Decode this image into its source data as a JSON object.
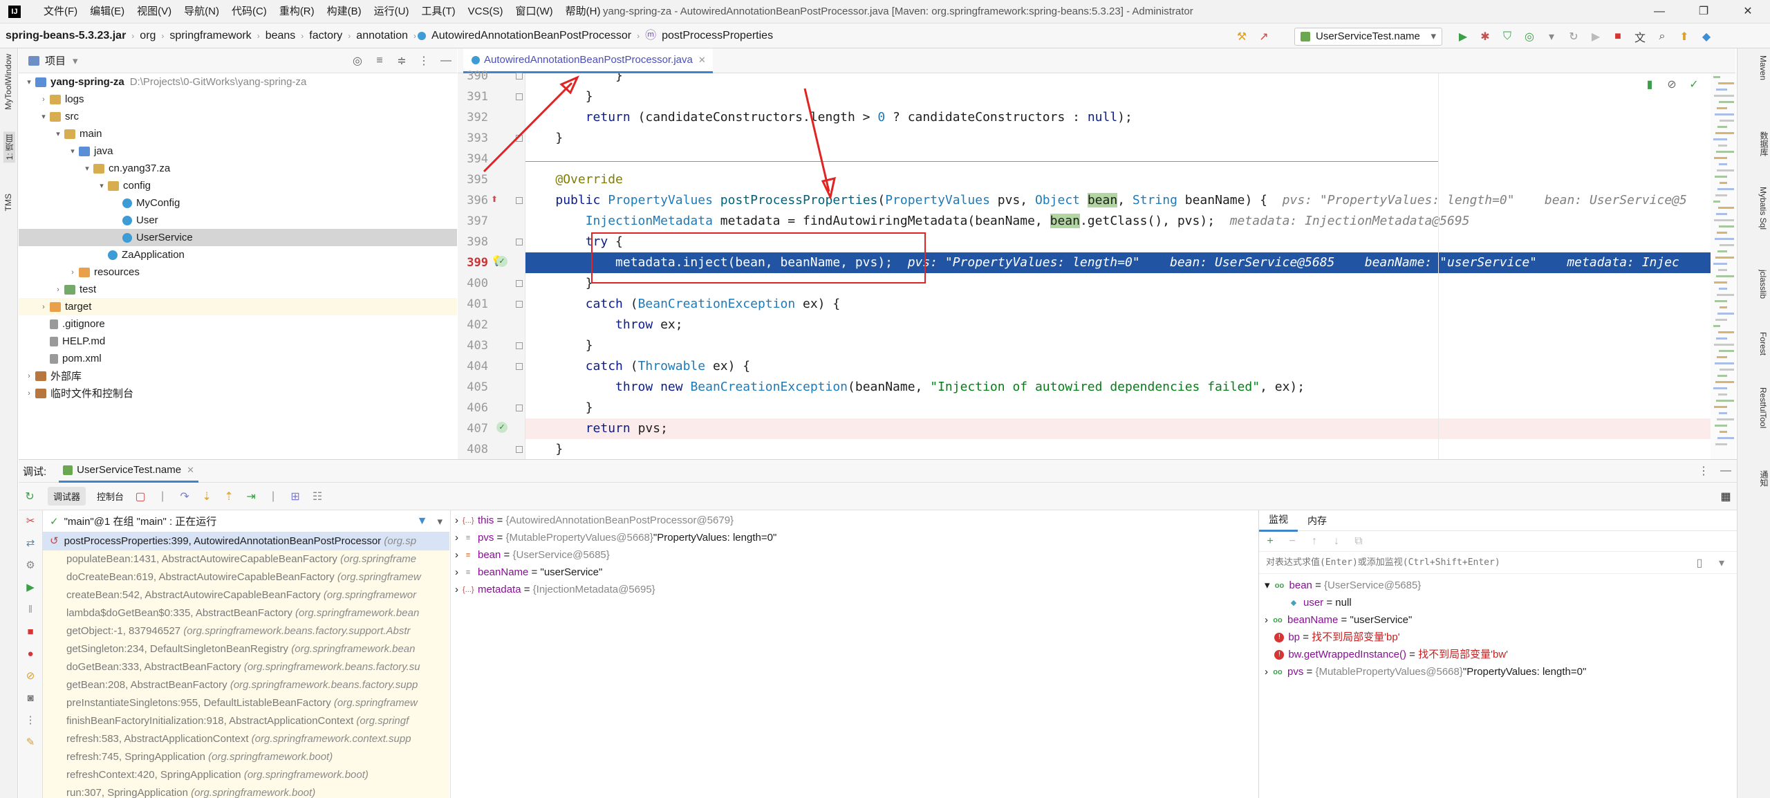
{
  "titlebar": {
    "menu": [
      "文件(F)",
      "编辑(E)",
      "视图(V)",
      "导航(N)",
      "代码(C)",
      "重构(R)",
      "构建(B)",
      "运行(U)",
      "工具(T)",
      "VCS(S)",
      "窗口(W)",
      "帮助(H)"
    ],
    "window_title": "yang-spring-za - AutowiredAnnotationBeanPostProcessor.java [Maven: org.springframework:spring-beans:5.3.23] - Administrator"
  },
  "navbar": {
    "breadcrumbs": [
      "spring-beans-5.3.23.jar",
      "org",
      "springframework",
      "beans",
      "factory",
      "annotation",
      "AutowiredAnnotationBeanPostProcessor",
      "postProcessProperties"
    ],
    "run_config": "UserServiceTest.name"
  },
  "left_stripe": [
    "MyToolWindow",
    "1: 项目",
    "TMS"
  ],
  "right_stripe": [
    "Maven",
    "数据库",
    "Mybatis Sql",
    "jclasslib",
    "Forest",
    "RestfulTool",
    "通知"
  ],
  "project": {
    "header": "项目",
    "tree": [
      {
        "label": "yang-spring-za",
        "path": "D:\\Projects\\0-GitWorks\\yang-spring-za",
        "depth": 0,
        "arrow": "▾",
        "icon": "folder-b",
        "bold": true
      },
      {
        "label": "logs",
        "depth": 1,
        "arrow": "›",
        "icon": "folder"
      },
      {
        "label": "src",
        "depth": 1,
        "arrow": "▾",
        "icon": "folder"
      },
      {
        "label": "main",
        "depth": 2,
        "arrow": "▾",
        "icon": "folder"
      },
      {
        "label": "java",
        "depth": 3,
        "arrow": "▾",
        "icon": "folder-b"
      },
      {
        "label": "cn.yang37.za",
        "depth": 4,
        "arrow": "▾",
        "icon": "folder"
      },
      {
        "label": "config",
        "depth": 5,
        "arrow": "▾",
        "icon": "folder"
      },
      {
        "label": "MyConfig",
        "depth": 6,
        "arrow": "",
        "icon": "class"
      },
      {
        "label": "User",
        "depth": 6,
        "arrow": "",
        "icon": "class"
      },
      {
        "label": "UserService",
        "depth": 6,
        "arrow": "",
        "icon": "class",
        "selected": true
      },
      {
        "label": "ZaApplication",
        "depth": 5,
        "arrow": "",
        "icon": "class"
      },
      {
        "label": "resources",
        "depth": 3,
        "arrow": "›",
        "icon": "folder-o"
      },
      {
        "label": "test",
        "depth": 2,
        "arrow": "›",
        "icon": "folder-g"
      },
      {
        "label": "target",
        "depth": 1,
        "arrow": "›",
        "icon": "folder-o",
        "excluded": true
      },
      {
        "label": ".gitignore",
        "depth": 1,
        "arrow": "",
        "icon": "file"
      },
      {
        "label": "HELP.md",
        "depth": 1,
        "arrow": "",
        "icon": "file"
      },
      {
        "label": "pom.xml",
        "depth": 1,
        "arrow": "",
        "icon": "file"
      },
      {
        "label": "外部库",
        "depth": 0,
        "arrow": "›",
        "icon": "lib"
      },
      {
        "label": "临时文件和控制台",
        "depth": 0,
        "arrow": "›",
        "icon": "lib"
      }
    ]
  },
  "editor": {
    "tab": "AutowiredAnnotationBeanPostProcessor.java",
    "line_numbers": [
      "390",
      "391",
      "392",
      "393",
      "394",
      "395",
      "396",
      "397",
      "398",
      "399",
      "400",
      "401",
      "402",
      "403",
      "404",
      "405",
      "406",
      "407",
      "408"
    ],
    "current_line": "399"
  },
  "debug": {
    "label": "调试:",
    "session_tab": "UserServiceTest.name",
    "sub_tabs": [
      "调试器",
      "控制台"
    ],
    "thread": "\"main\"@1 在组 \"main\" : 正在运行",
    "frames": [
      {
        "method": "postProcessProperties:399, AutowiredAnnotationBeanPostProcessor",
        "pkg": "(org.sp"
      },
      {
        "method": "populateBean:1431, AbstractAutowireCapableBeanFactory",
        "pkg": "(org.springframe"
      },
      {
        "method": "doCreateBean:619, AbstractAutowireCapableBeanFactory",
        "pkg": "(org.springframew"
      },
      {
        "method": "createBean:542, AbstractAutowireCapableBeanFactory",
        "pkg": "(org.springframewor"
      },
      {
        "method": "lambda$doGetBean$0:335, AbstractBeanFactory",
        "pkg": "(org.springframework.bean"
      },
      {
        "method": "getObject:-1, 837946527",
        "pkg": "(org.springframework.beans.factory.support.Abstr"
      },
      {
        "method": "getSingleton:234, DefaultSingletonBeanRegistry",
        "pkg": "(org.springframework.bean"
      },
      {
        "method": "doGetBean:333, AbstractBeanFactory",
        "pkg": "(org.springframework.beans.factory.su"
      },
      {
        "method": "getBean:208, AbstractBeanFactory",
        "pkg": "(org.springframework.beans.factory.supp"
      },
      {
        "method": "preInstantiateSingletons:955, DefaultListableBeanFactory",
        "pkg": "(org.springframew"
      },
      {
        "method": "finishBeanFactoryInitialization:918, AbstractApplicationContext",
        "pkg": "(org.springf"
      },
      {
        "method": "refresh:583, AbstractApplicationContext",
        "pkg": "(org.springframework.context.supp"
      },
      {
        "method": "refresh:745, SpringApplication",
        "pkg": "(org.springframework.boot)"
      },
      {
        "method": "refreshContext:420, SpringApplication",
        "pkg": "(org.springframework.boot)"
      },
      {
        "method": "run:307, SpringApplication",
        "pkg": "(org.springframework.boot)"
      }
    ],
    "variables": [
      {
        "name": "this",
        "value": "{AutowiredAnnotationBeanPostProcessor@5679}",
        "extra": ""
      },
      {
        "name": "pvs",
        "value": "{MutablePropertyValues@5668}",
        "extra": "\"PropertyValues: length=0\""
      },
      {
        "name": "bean",
        "value": "{UserService@5685}",
        "extra": ""
      },
      {
        "name": "beanName",
        "value": "",
        "extra": "\"userService\""
      },
      {
        "name": "metadata",
        "value": "{InjectionMetadata@5695}",
        "extra": ""
      }
    ],
    "watch_tabs": [
      "监视",
      "内存"
    ],
    "watch_placeholder": "对表达式求值(Enter)或添加监视(Ctrl+Shift+Enter)",
    "watches": [
      {
        "name": "bean",
        "value": "{UserService@5685}",
        "extra": "",
        "kind": "watch",
        "expanded": true
      },
      {
        "name": "user",
        "value": "",
        "extra": "null",
        "kind": "field",
        "child": true
      },
      {
        "name": "beanName",
        "value": "",
        "extra": "\"userService\"",
        "kind": "watch"
      },
      {
        "name": "bp",
        "value": "",
        "extra": "找不到局部变量'bp'",
        "kind": "error"
      },
      {
        "name": "bw.getWrappedInstance()",
        "value": "",
        "extra": "找不到局部变量'bw'",
        "kind": "error"
      },
      {
        "name": "pvs",
        "value": "{MutablePropertyValues@5668}",
        "extra": "\"PropertyValues: length=0\"",
        "kind": "watch"
      }
    ]
  }
}
